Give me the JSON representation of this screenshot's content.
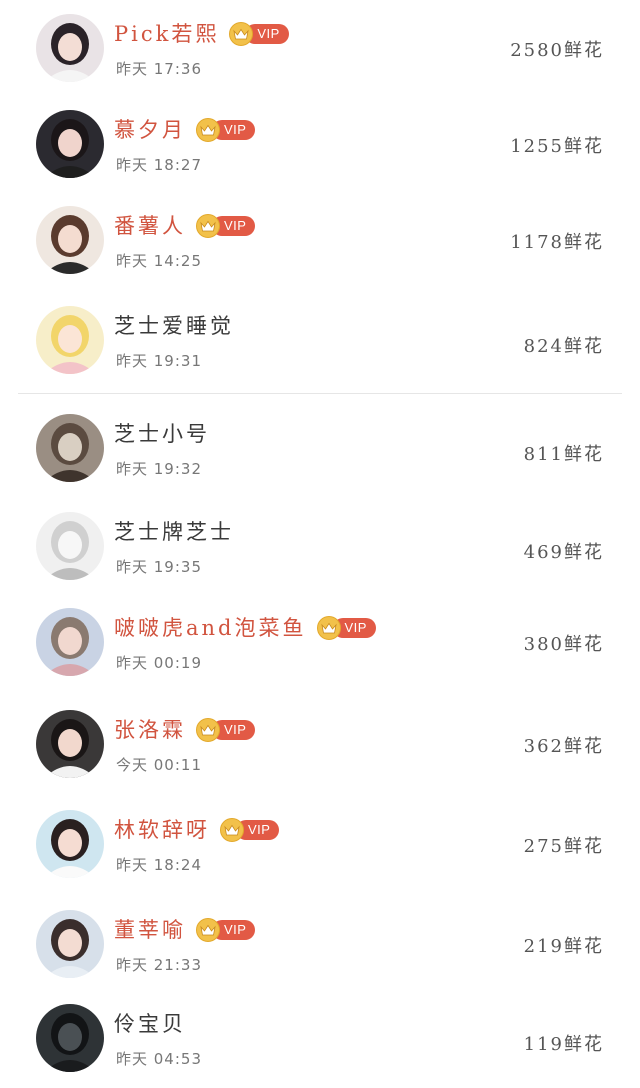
{
  "flower_unit": "鲜花",
  "ranking": [
    {
      "name": "Pick若熙",
      "vip": true,
      "vip_label": "VIP",
      "time": "昨天 17:36",
      "flowers": "2580"
    },
    {
      "name": "慕夕月",
      "vip": true,
      "vip_label": "VIP",
      "time": "昨天 18:27",
      "flowers": "1255"
    },
    {
      "name": "番薯人",
      "vip": true,
      "vip_label": "VIP",
      "time": "昨天 14:25",
      "flowers": "1178"
    },
    {
      "name": "芝士爱睡觉",
      "vip": false,
      "vip_label": "",
      "time": "昨天 19:31",
      "flowers": "824"
    },
    {
      "name": "芝士小号",
      "vip": false,
      "vip_label": "",
      "time": "昨天 19:32",
      "flowers": "811"
    },
    {
      "name": "芝士牌芝士",
      "vip": false,
      "vip_label": "",
      "time": "昨天 19:35",
      "flowers": "469"
    },
    {
      "name": "啵啵虎and泡菜鱼",
      "vip": true,
      "vip_label": "VIP",
      "time": "昨天 00:19",
      "flowers": "380"
    },
    {
      "name": "张洛霖",
      "vip": true,
      "vip_label": "VIP",
      "time": "今天 00:11",
      "flowers": "362"
    },
    {
      "name": "林软辞呀",
      "vip": true,
      "vip_label": "VIP",
      "time": "昨天 18:24",
      "flowers": "275"
    },
    {
      "name": "董莘喻",
      "vip": true,
      "vip_label": "VIP",
      "time": "昨天 21:33",
      "flowers": "219"
    },
    {
      "name": "伶宝贝",
      "vip": false,
      "vip_label": "",
      "time": "昨天 04:53",
      "flowers": "119"
    }
  ],
  "colors": {
    "vip_name": "#d1543f",
    "vip_badge": "#e25a45",
    "crown": "#f2c14a"
  }
}
